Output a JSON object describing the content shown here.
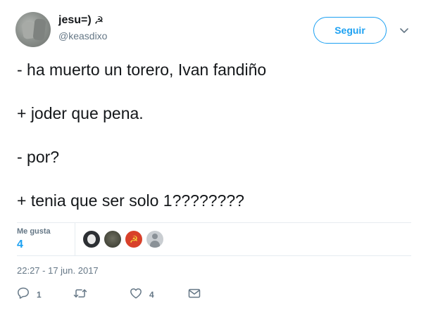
{
  "user": {
    "display_name": "jesu=)",
    "name_emoji": "☭",
    "handle": "@keasdixo",
    "avatar": "user-avatar"
  },
  "follow_button": {
    "label": "Seguir"
  },
  "menu_icon": "chevron-down-icon",
  "tweet": {
    "lines": [
      "- ha muerto un torero, Ivan fandiño",
      "+ joder que pena.",
      "- por?",
      "+ tenia que ser solo 1????????"
    ]
  },
  "stats": {
    "likes_label": "Me gusta",
    "likes_count": "4",
    "likers": [
      "liker-avatar-1",
      "liker-avatar-2",
      "liker-avatar-3",
      "liker-avatar-4"
    ]
  },
  "timestamp": "22:27 - 17 jun. 2017",
  "actions": {
    "reply": {
      "icon": "reply-icon",
      "count": "1"
    },
    "retweet": {
      "icon": "retweet-icon",
      "count": ""
    },
    "like": {
      "icon": "heart-icon",
      "count": "4"
    },
    "dm": {
      "icon": "envelope-icon"
    }
  },
  "colors": {
    "accent": "#1da1f2",
    "text": "#14171a",
    "secondary": "#657786",
    "border": "#e6ecf0"
  }
}
